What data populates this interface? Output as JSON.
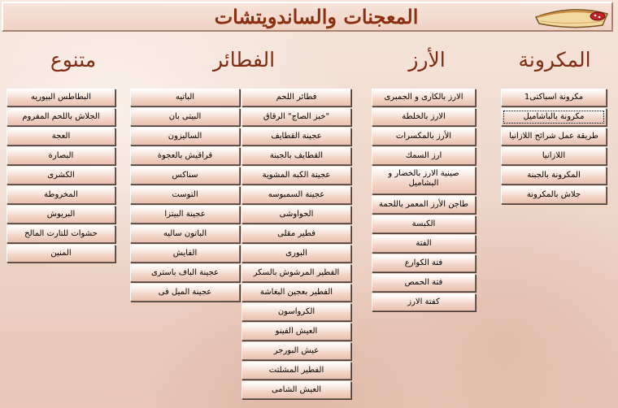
{
  "header": {
    "title": "المعجنات والساندويتشات"
  },
  "categories": {
    "pasta": {
      "title": "المكرونة",
      "items": [
        "مكرونة اسباكتى1",
        "مكرونة بالباشاميل",
        "طريقة عمل شرائح اللازانيا",
        "اللازانيا",
        "المكرونة بالجبنة",
        "جلاش بالمكرونة"
      ]
    },
    "rice": {
      "title": "الأرز",
      "items": [
        "الارز بالكارى و الجمبرى",
        "الارز بالخلطة",
        "الأرز بالمكسرات",
        "ارز السمك",
        "صينية الارز بالخضار و البشاميل",
        "طاجن الأرز المعمر باللحمة",
        "الكبسة",
        "الفتة",
        "فتة الكوارع",
        "فتة الحمص",
        "كفتة الارز"
      ]
    },
    "pies": {
      "title": "الفطائر",
      "col_a": [
        "فطائر اللحم",
        "\"خبز الصاج\" الرقاق",
        "عجينة القطايف",
        "القطايف بالجبنة",
        "عجينة الكبه المشوية",
        "عجينة السمبوسه",
        "الحواوشى",
        "فطير مقلى",
        "البورى",
        "الفطير المرشوش بالسكر",
        "الفطير بعجين البغاشة",
        "الكرواسون",
        "العيش الفينو",
        "عيش البورجر",
        "الفطير المشلتت",
        "العيش الشامى"
      ],
      "col_b": [
        "الباتيه",
        "البيتى بان",
        "الساليزون",
        "قراقيش بالعجوة",
        "سناكس",
        "التوست",
        "عجينة البيتزا",
        "الباتون ساليه",
        "الفايش",
        "عجينة الباف باسترى",
        "عجينة الميل فى"
      ]
    },
    "misc": {
      "title": "متنوع",
      "items": [
        "البطاطس البيوريه",
        "الجلاش باللحم المفروم",
        "العجة",
        "البصارة",
        "الكشرى",
        "المخروطة",
        "البريوش",
        "حشوات للتارت المالح",
        "المنين"
      ]
    }
  },
  "colors": {
    "title": "#8a2f10",
    "category": "#7e2b10",
    "button_bottom": "#e9c0ae"
  },
  "icons": {
    "logo": "pie-slice-icon"
  }
}
